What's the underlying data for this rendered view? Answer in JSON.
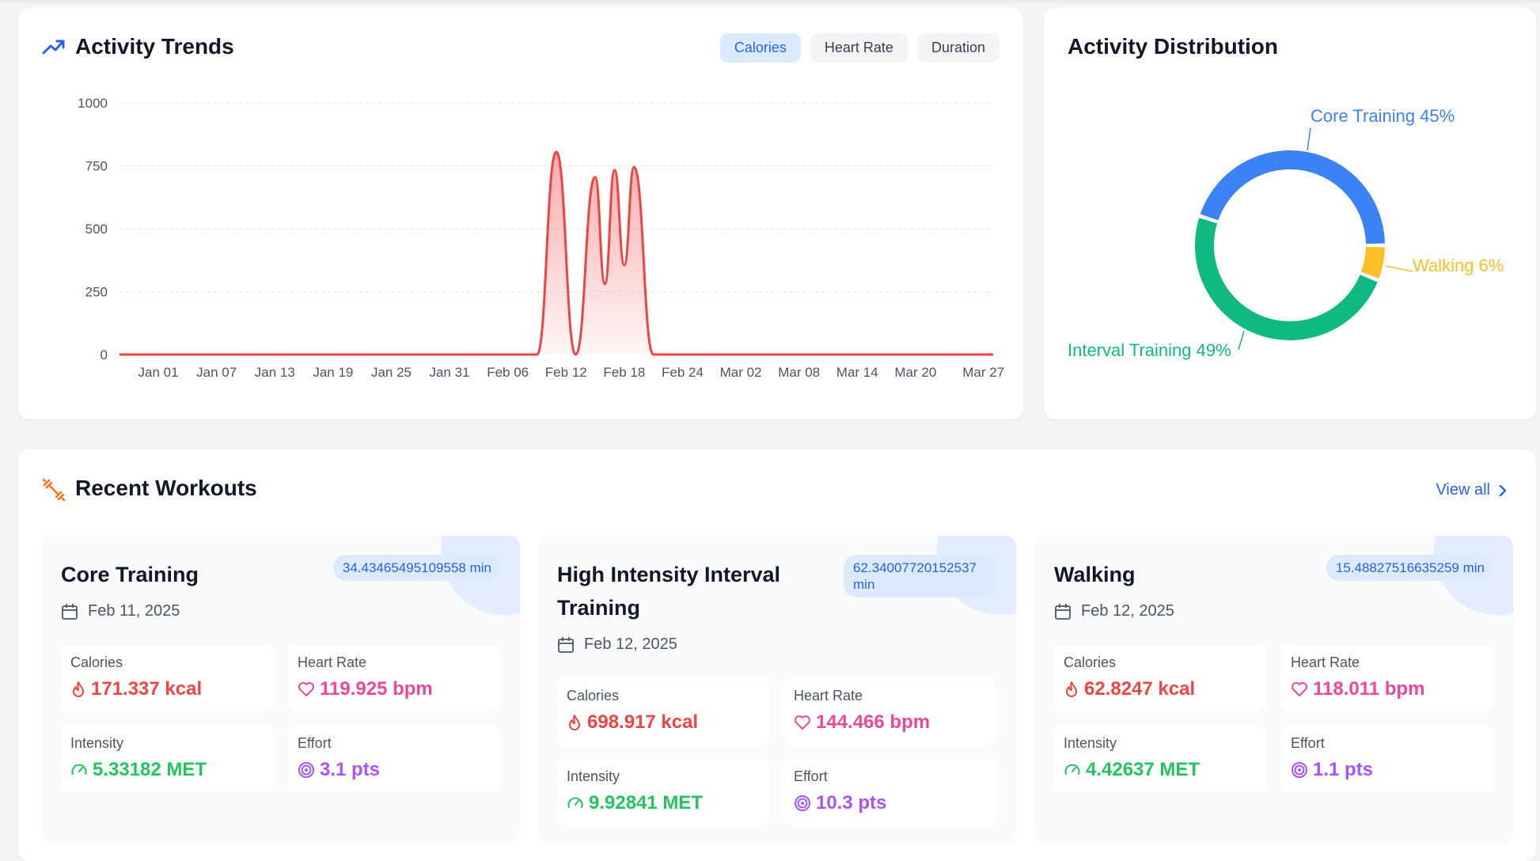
{
  "trends": {
    "title": "Activity Trends",
    "tabs": [
      {
        "label": "Calories",
        "active": true
      },
      {
        "label": "Heart Rate",
        "active": false
      },
      {
        "label": "Duration",
        "active": false
      }
    ]
  },
  "chart_data": [
    {
      "type": "area",
      "title": "Activity Trends",
      "ylim": [
        0,
        1000
      ],
      "y_ticks": [
        0,
        250,
        500,
        750,
        1000
      ],
      "x_tick_labels": [
        "Jan 01",
        "Jan 07",
        "Jan 13",
        "Jan 19",
        "Jan 25",
        "Jan 31",
        "Feb 06",
        "Feb 12",
        "Feb 18",
        "Feb 24",
        "Mar 02",
        "Mar 08",
        "Mar 14",
        "Mar 20",
        "Mar 27"
      ],
      "x_range": [
        "Dec 28",
        "Mar 28"
      ],
      "series": [
        {
          "color": "#ef4444",
          "points": [
            {
              "x": "Feb 09",
              "y": 0
            },
            {
              "x": "Feb 11",
              "y": 805
            },
            {
              "x": "Feb 13",
              "y": 0
            },
            {
              "x": "Feb 15",
              "y": 705
            },
            {
              "x": "Feb 16",
              "y": 280
            },
            {
              "x": "Feb 17",
              "y": 733
            },
            {
              "x": "Feb 18",
              "y": 355
            },
            {
              "x": "Feb 19",
              "y": 745
            },
            {
              "x": "Feb 21",
              "y": 0
            }
          ]
        }
      ],
      "grid": true
    },
    {
      "type": "pie",
      "title": "Activity Distribution",
      "slices": [
        {
          "label": "Core Training",
          "value": 45,
          "color": "#3b82f6"
        },
        {
          "label": "Walking",
          "value": 6,
          "color": "#fbbf24"
        },
        {
          "label": "Interval Training",
          "value": 49,
          "color": "#10b981"
        }
      ]
    }
  ],
  "distribution": {
    "title": "Activity Distribution",
    "labels": [
      "Core Training 45%",
      "Walking 6%",
      "Interval Training 49%"
    ]
  },
  "workouts": {
    "title": "Recent Workouts",
    "view_all": "View all",
    "cards": [
      {
        "name": "Core Training",
        "duration": "34.43465495109558 min",
        "date": "Feb 11, 2025",
        "calories_label": "Calories",
        "calories": "171.337 kcal",
        "heart_label": "Heart Rate",
        "heart": "119.925 bpm",
        "intensity_label": "Intensity",
        "intensity": "5.33182 MET",
        "effort_label": "Effort",
        "effort": "3.1 pts"
      },
      {
        "name": "High Intensity Interval Training",
        "duration": "62.34007720152537 min",
        "date": "Feb 12, 2025",
        "calories_label": "Calories",
        "calories": "698.917 kcal",
        "heart_label": "Heart Rate",
        "heart": "144.466 bpm",
        "intensity_label": "Intensity",
        "intensity": "9.92841 MET",
        "effort_label": "Effort",
        "effort": "10.3 pts"
      },
      {
        "name": "Walking",
        "duration": "15.48827516635259 min",
        "date": "Feb 12, 2025",
        "calories_label": "Calories",
        "calories": "62.8247 kcal",
        "heart_label": "Heart Rate",
        "heart": "118.011 bpm",
        "intensity_label": "Intensity",
        "intensity": "4.42637 MET",
        "effort_label": "Effort",
        "effort": "1.1 pts"
      }
    ]
  }
}
